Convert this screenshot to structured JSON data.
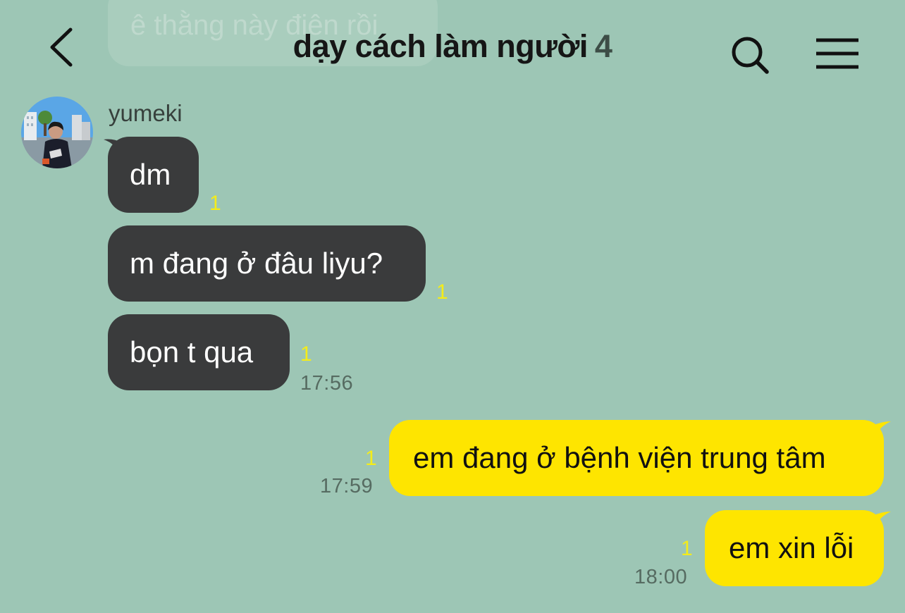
{
  "header": {
    "title": "dạy cách làm người",
    "member_count": "4",
    "back_icon": "chevron-left-icon",
    "search_icon": "search-icon",
    "menu_icon": "hamburger-menu-icon"
  },
  "ghost_message": {
    "text": "ê thằng này điên rồi"
  },
  "sender": {
    "name": "yumeki"
  },
  "incoming": [
    {
      "text": "dm",
      "unread": "1"
    },
    {
      "text": "m đang ở đâu liyu?",
      "unread": "1"
    },
    {
      "text": "bọn t qua",
      "unread": "1",
      "time": "17:56"
    }
  ],
  "outgoing": [
    {
      "text": "em đang ở bệnh viện trung tâm",
      "unread": "1",
      "time": "17:59"
    },
    {
      "text": "em xin lỗi",
      "unread": "1",
      "time": "18:00"
    }
  ],
  "colors": {
    "background": "#9dc6b5",
    "incoming_bubble": "#3a3b3c",
    "outgoing_bubble": "#fee500",
    "unread_count": "#f4ec1a"
  }
}
